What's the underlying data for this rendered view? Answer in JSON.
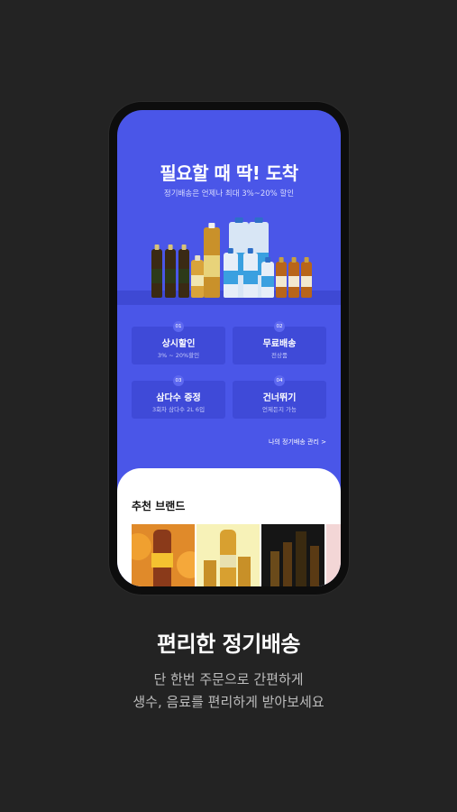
{
  "hero": {
    "title": "필요할 때 딱! 도착",
    "subtitle": "정기배송은 언제나 최대 3%~20% 할인"
  },
  "benefits": [
    {
      "num": "01",
      "title": "상시할인",
      "desc": "3% ~ 20%할인"
    },
    {
      "num": "02",
      "title": "무료배송",
      "desc": "전상품"
    },
    {
      "num": "03",
      "title": "삼다수 증정",
      "desc": "3회차 삼다수 2L 6입"
    },
    {
      "num": "04",
      "title": "건너뛰기",
      "desc": "언제든지 가능"
    }
  ],
  "manage_link": "나의 정기배송 관리 >",
  "recommended": {
    "title": "추천 브랜드"
  },
  "caption": {
    "title": "편리한 정기배송",
    "line1": "단 한번 주문으로 간편하게",
    "line2": "생수, 음료를 편리하게 받아보세요"
  },
  "colors": {
    "background": "#232323",
    "hero_blue": "#4a56e8",
    "card_blue": "#3f4ad8"
  }
}
